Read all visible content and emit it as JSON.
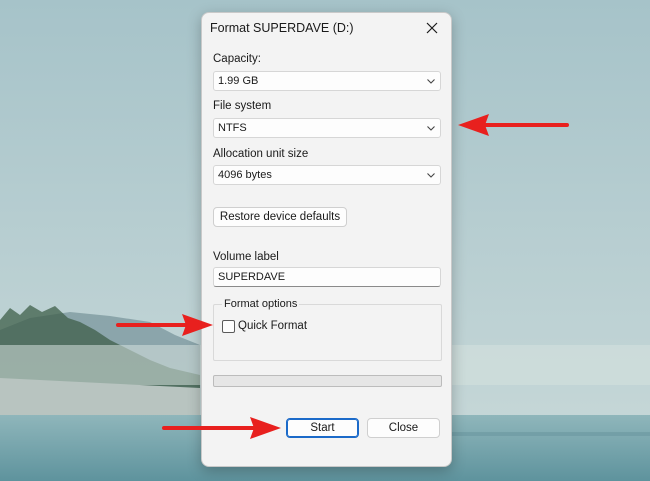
{
  "window": {
    "title": "Format SUPERDAVE (D:)",
    "close_icon": "close-icon"
  },
  "capacity": {
    "label": "Capacity:",
    "value": "1.99 GB"
  },
  "file_system": {
    "label": "File system",
    "value": "NTFS"
  },
  "allocation": {
    "label": "Allocation unit size",
    "value": "4096 bytes"
  },
  "buttons": {
    "restore": "Restore device defaults",
    "start": "Start",
    "close": "Close"
  },
  "volume": {
    "label": "Volume label",
    "value": "SUPERDAVE"
  },
  "format_options": {
    "legend": "Format options",
    "quick_format_label": "Quick Format",
    "quick_format_checked": false
  },
  "progress": {
    "value": 0
  },
  "annotations": {
    "arrow_color": "#e8201e",
    "arrows": [
      "file-system-arrow",
      "quick-format-arrow",
      "start-arrow"
    ]
  }
}
